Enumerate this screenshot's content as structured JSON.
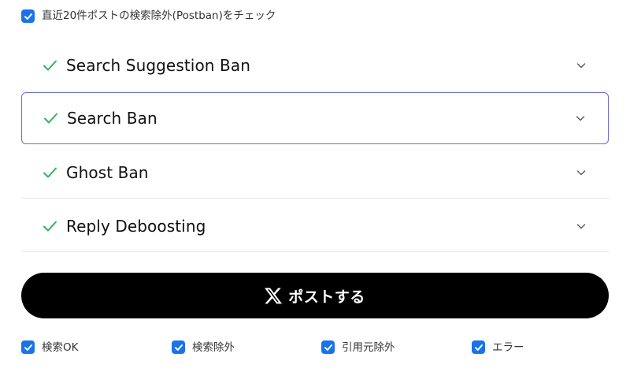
{
  "top_option": {
    "label": "直近20件ポストの検索除外(Postban)をチェック",
    "checked": true
  },
  "ban_checks": [
    {
      "label": "Search Suggestion Ban",
      "status": "passed"
    },
    {
      "label": "Search Ban",
      "status": "passed",
      "selected": true
    },
    {
      "label": "Ghost Ban",
      "status": "passed"
    },
    {
      "label": "Reply Deboosting",
      "status": "passed"
    }
  ],
  "post_button": {
    "label": "ポストする",
    "icon": "x-logo-icon"
  },
  "filters": [
    {
      "label": "検索OK",
      "checked": true
    },
    {
      "label": "検索除外",
      "checked": true
    },
    {
      "label": "引用元除外",
      "checked": true
    },
    {
      "label": "エラー",
      "checked": true
    }
  ],
  "colors": {
    "accent": "#1a73e8",
    "check_green": "#2fb35a",
    "selected_border": "#6b6fd0"
  }
}
